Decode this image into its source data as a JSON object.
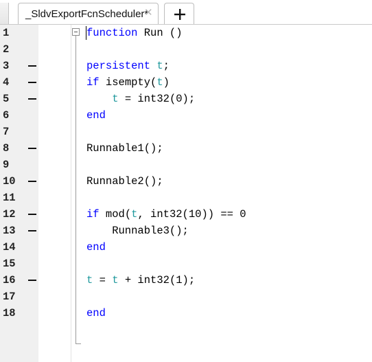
{
  "tab": {
    "title": "_SldvExportFcnScheduler*",
    "close_glyph": "✕",
    "new_tab_icon": "plus-icon"
  },
  "editor": {
    "lines": [
      {
        "n": "1",
        "bp": false,
        "tokens": [
          {
            "t": "function",
            "c": "kw"
          },
          {
            "t": " Run ()",
            "c": ""
          }
        ]
      },
      {
        "n": "2",
        "bp": false,
        "tokens": []
      },
      {
        "n": "3",
        "bp": true,
        "tokens": [
          {
            "t": "persistent ",
            "c": "kw"
          },
          {
            "t": "t",
            "c": "var"
          },
          {
            "t": ";",
            "c": ""
          }
        ]
      },
      {
        "n": "4",
        "bp": true,
        "tokens": [
          {
            "t": "if",
            "c": "kw"
          },
          {
            "t": " isempty(",
            "c": ""
          },
          {
            "t": "t",
            "c": "var"
          },
          {
            "t": ")",
            "c": ""
          }
        ]
      },
      {
        "n": "5",
        "bp": true,
        "tokens": [
          {
            "t": "    ",
            "c": ""
          },
          {
            "t": "t",
            "c": "var"
          },
          {
            "t": " = int32(0);",
            "c": ""
          }
        ]
      },
      {
        "n": "6",
        "bp": false,
        "tokens": [
          {
            "t": "end",
            "c": "kw"
          }
        ]
      },
      {
        "n": "7",
        "bp": false,
        "tokens": []
      },
      {
        "n": "8",
        "bp": true,
        "tokens": [
          {
            "t": "Runnable1();",
            "c": ""
          }
        ]
      },
      {
        "n": "9",
        "bp": false,
        "tokens": []
      },
      {
        "n": "10",
        "bp": true,
        "tokens": [
          {
            "t": "Runnable2();",
            "c": ""
          }
        ]
      },
      {
        "n": "11",
        "bp": false,
        "tokens": []
      },
      {
        "n": "12",
        "bp": true,
        "tokens": [
          {
            "t": "if",
            "c": "kw"
          },
          {
            "t": " mod(",
            "c": ""
          },
          {
            "t": "t",
            "c": "var"
          },
          {
            "t": ", int32(10)) == 0",
            "c": ""
          }
        ]
      },
      {
        "n": "13",
        "bp": true,
        "tokens": [
          {
            "t": "    Runnable3();",
            "c": ""
          }
        ]
      },
      {
        "n": "14",
        "bp": false,
        "tokens": [
          {
            "t": "end",
            "c": "kw"
          }
        ]
      },
      {
        "n": "15",
        "bp": false,
        "tokens": []
      },
      {
        "n": "16",
        "bp": true,
        "tokens": [
          {
            "t": "t",
            "c": "var"
          },
          {
            "t": " = ",
            "c": ""
          },
          {
            "t": "t",
            "c": "var"
          },
          {
            "t": " + int32(1);",
            "c": ""
          }
        ]
      },
      {
        "n": "17",
        "bp": false,
        "tokens": []
      },
      {
        "n": "18",
        "bp": false,
        "tokens": [
          {
            "t": "end",
            "c": "kw"
          }
        ]
      }
    ]
  },
  "colors": {
    "keyword": "#0000ff",
    "variable": "#20999d",
    "text": "#000000",
    "gutter": "#f0f0f0"
  }
}
